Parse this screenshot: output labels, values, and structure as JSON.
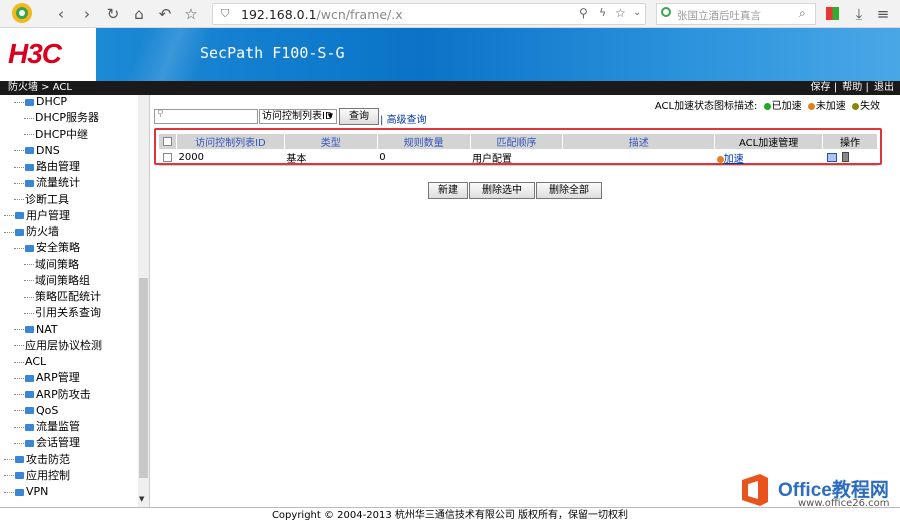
{
  "browser": {
    "url_main": "192.168.0.1",
    "url_rest": "/wcn/frame/.x",
    "search_placeholder": "张国立酒后吐真言"
  },
  "header": {
    "logo": "H3C",
    "product": "SecPath F100-S-G"
  },
  "breadcrumb": "防火墙 > ACL",
  "top_menu": [
    "保存",
    "帮助",
    "退出"
  ],
  "sidebar": {
    "items": [
      {
        "label": "DHCP",
        "type": "folder",
        "indent": 2
      },
      {
        "label": "DHCP服务器",
        "type": "leaf",
        "indent": 3
      },
      {
        "label": "DHCP中继",
        "type": "leaf",
        "indent": 3
      },
      {
        "label": "DNS",
        "type": "folder",
        "indent": 2
      },
      {
        "label": "路由管理",
        "type": "folder",
        "indent": 2
      },
      {
        "label": "流量统计",
        "type": "folder",
        "indent": 2
      },
      {
        "label": "诊断工具",
        "type": "leaf",
        "indent": 2
      },
      {
        "label": "用户管理",
        "type": "folder",
        "indent": 1
      },
      {
        "label": "防火墙",
        "type": "folder",
        "indent": 1
      },
      {
        "label": "安全策略",
        "type": "folder",
        "indent": 2
      },
      {
        "label": "域间策略",
        "type": "leaf",
        "indent": 3
      },
      {
        "label": "域间策略组",
        "type": "leaf",
        "indent": 3
      },
      {
        "label": "策略匹配统计",
        "type": "leaf",
        "indent": 3
      },
      {
        "label": "引用关系查询",
        "type": "leaf",
        "indent": 3
      },
      {
        "label": "NAT",
        "type": "folder",
        "indent": 2
      },
      {
        "label": "应用层协议检测",
        "type": "leaf",
        "indent": 2
      },
      {
        "label": "ACL",
        "type": "leaf",
        "indent": 2
      },
      {
        "label": "ARP管理",
        "type": "folder",
        "indent": 2
      },
      {
        "label": "ARP防攻击",
        "type": "folder",
        "indent": 2
      },
      {
        "label": "QoS",
        "type": "folder",
        "indent": 2
      },
      {
        "label": "流量监管",
        "type": "folder",
        "indent": 2
      },
      {
        "label": "会话管理",
        "type": "folder",
        "indent": 2
      },
      {
        "label": "攻击防范",
        "type": "folder",
        "indent": 1
      },
      {
        "label": "应用控制",
        "type": "folder",
        "indent": 1
      },
      {
        "label": "VPN",
        "type": "folder",
        "indent": 1
      }
    ]
  },
  "legend": {
    "title": "ACL加速状态图标描述:",
    "items": [
      {
        "label": "已加速",
        "color": "#22aa22"
      },
      {
        "label": "未加速",
        "color": "#e08020"
      },
      {
        "label": "失效",
        "color": "#888800"
      }
    ]
  },
  "filter": {
    "select_value": "访问控制列表ID",
    "query_label": "查询",
    "advanced_label": "高级查询"
  },
  "table": {
    "headers": [
      "访问控制列表ID",
      "类型",
      "规则数量",
      "匹配顺序",
      "描述",
      "ACL加速管理",
      "操作"
    ],
    "rows": [
      {
        "id": "2000",
        "type": "基本",
        "rules": "0",
        "order": "用户配置",
        "desc": "",
        "accel": "加速"
      }
    ]
  },
  "buttons": {
    "new": "新建",
    "delete_selected": "删除选中",
    "delete_all": "删除全部"
  },
  "footer": "Copyright © 2004-2013 杭州华三通信技术有限公司 版权所有，保留一切权利",
  "watermark": {
    "text": "Office教程网",
    "sub": "www.office26.com"
  }
}
